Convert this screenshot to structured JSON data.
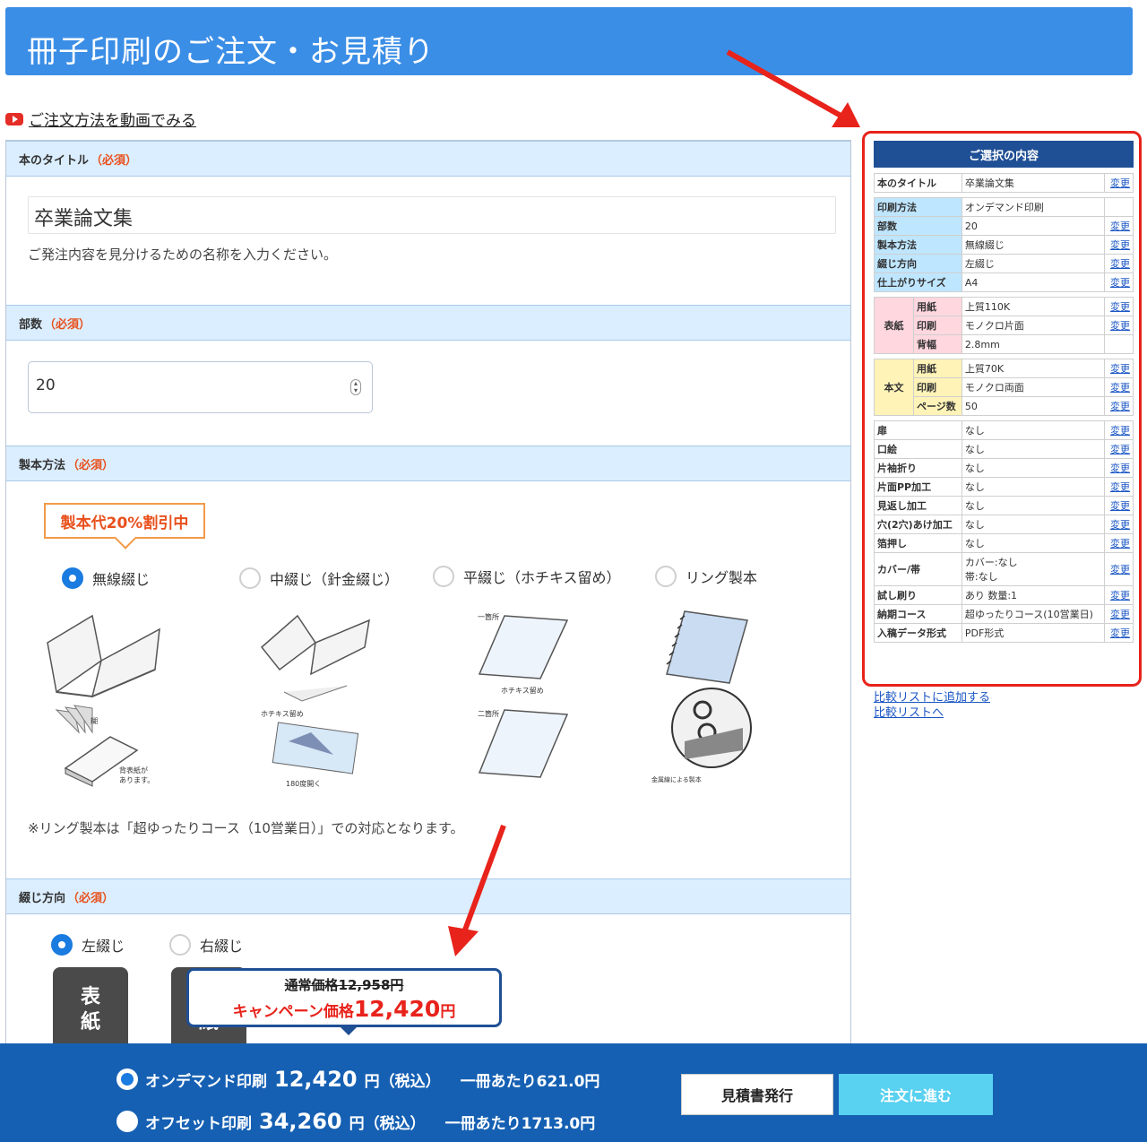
{
  "header": {
    "title": "冊子印刷のご注文・お見積り"
  },
  "video_link": "ご注文方法を動画でみる",
  "sections": {
    "title": {
      "label": "本のタイトル",
      "required": "（必須）",
      "value": "卒業論文集",
      "hint": "ご発注内容を見分けるための名称を入力ください。"
    },
    "copies": {
      "label": "部数",
      "required": "（必須）",
      "value": "20"
    },
    "binding": {
      "label": "製本方法",
      "required": "（必須）",
      "discount": "製本代20%割引中",
      "options": [
        "無線綴じ",
        "中綴じ（針金綴じ）",
        "平綴じ（ホチキス留め）",
        "リング製本"
      ],
      "selected": "無線綴じ",
      "captions": {
        "perfect_1": "糊",
        "perfect_2": "背表紙が\nあります。",
        "saddle_1": "ホチキス留め",
        "saddle_2": "180度開く",
        "flat_1": "一箇所",
        "flat_2": "ホチキス留め",
        "flat_3": "二箇所",
        "ring_1": "金属線による製本"
      },
      "note": "※リング製本は「超ゆったりコース（10営業日）」での対応となります。"
    },
    "direction": {
      "label": "綴じ方向",
      "required": "（必須）",
      "options": [
        "左綴じ",
        "右綴じ"
      ],
      "selected": "左綴じ",
      "cover_text": "表\n紙",
      "cover_text_2": "紙"
    }
  },
  "price_popup": {
    "old": "通常価格12,958円",
    "campaign_prefix": "キャンペーン価格",
    "campaign_value": "12,420",
    "campaign_suffix": "円"
  },
  "footer": {
    "rows": [
      {
        "name": "オンデマンド印刷",
        "price": "12,420",
        "unit": "円（税込）",
        "per": "一冊あたり621.0円",
        "selected": true
      },
      {
        "name": "オフセット印刷",
        "price": "34,260",
        "unit": "円（税込）",
        "per": "一冊あたり1713.0円",
        "selected": false
      }
    ],
    "quote_button": "見積書発行",
    "order_button": "注文に進む"
  },
  "summary": {
    "title": "ご選択の内容",
    "change": "変更",
    "rows_top": [
      {
        "k": "本のタイトル",
        "v": "卒業論文集",
        "change": true
      },
      {
        "k": "印刷方法",
        "v": "オンデマンド印刷",
        "change": false
      },
      {
        "k": "部数",
        "v": "20",
        "change": true
      },
      {
        "k": "製本方法",
        "v": "無線綴じ",
        "change": true
      },
      {
        "k": "綴じ方向",
        "v": "左綴じ",
        "change": true
      },
      {
        "k": "仕上がりサイズ",
        "v": "A4",
        "change": true
      }
    ],
    "cover_group": "表紙",
    "cover_rows": [
      {
        "k": "用紙",
        "v": "上質110K",
        "change": true
      },
      {
        "k": "印刷",
        "v": "モノクロ片面",
        "change": true
      },
      {
        "k": "背幅",
        "v": "2.8mm",
        "change": false
      }
    ],
    "body_group": "本文",
    "body_rows": [
      {
        "k": "用紙",
        "v": "上質70K",
        "change": true
      },
      {
        "k": "印刷",
        "v": "モノクロ両面",
        "change": true
      },
      {
        "k": "ページ数",
        "v": "50",
        "change": true
      }
    ],
    "rows_bottom": [
      {
        "k": "扉",
        "v": "なし"
      },
      {
        "k": "口絵",
        "v": "なし"
      },
      {
        "k": "片袖折り",
        "v": "なし"
      },
      {
        "k": "片面PP加工",
        "v": "なし"
      },
      {
        "k": "見返し加工",
        "v": "なし"
      },
      {
        "k": "穴(2穴)あけ加工",
        "v": "なし"
      },
      {
        "k": "箔押し",
        "v": "なし"
      },
      {
        "k": "カバー/帯",
        "v": "カバー:なし\n帯:なし"
      },
      {
        "k": "試し刷り",
        "v": "あり 数量:1"
      },
      {
        "k": "納期コース",
        "v": "超ゆったりコース(10営業日)"
      },
      {
        "k": "入稿データ形式",
        "v": "PDF形式"
      }
    ],
    "links": [
      "比較リストに追加する",
      "比較リストへ"
    ]
  },
  "colors": {
    "header": "#3b8ee6",
    "footer": "#1560b3",
    "accent_red": "#e8231b",
    "required": "#e8501c",
    "order_button": "#59d1f0"
  }
}
